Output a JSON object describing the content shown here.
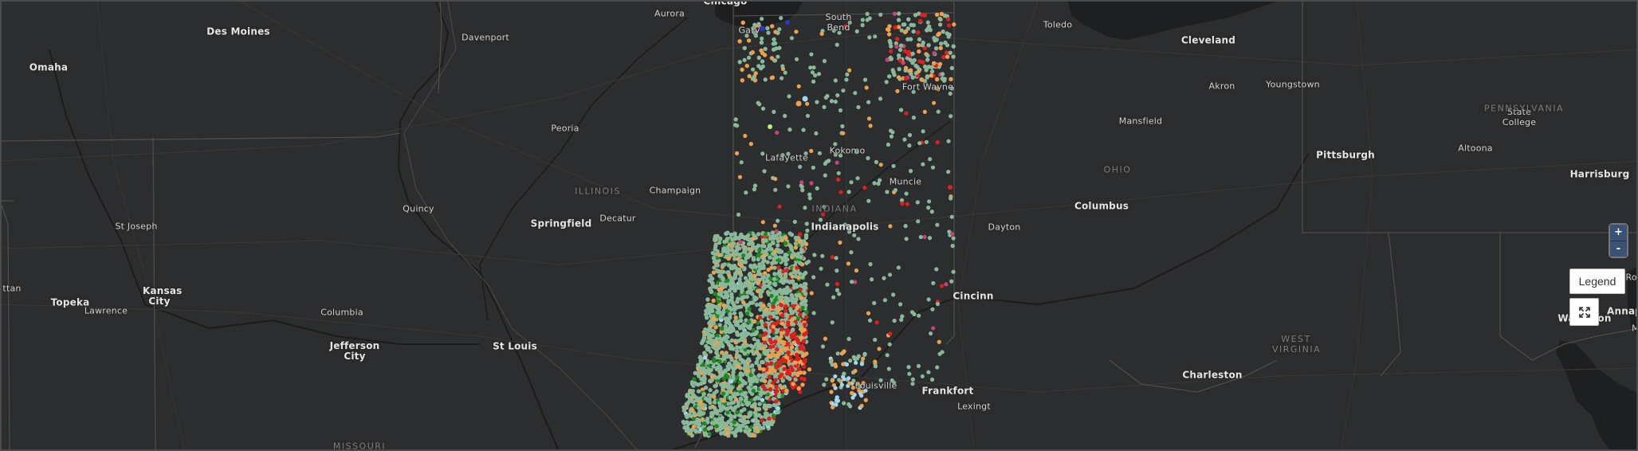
{
  "map": {
    "background": "#2c2d2e",
    "land_color": "#2c2d2e",
    "water_color": "#1e1f20",
    "road_color": "#343536",
    "border_color": "#4c4d4e",
    "points": {
      "colors": {
        "sage": "#8ab89a",
        "green": "#1f8a1f",
        "orange": "#f0a04b",
        "red": "#e01e1e",
        "light_blue": "#9fd8f2",
        "magenta": "#c8427a",
        "blue": "#2c36c8",
        "lime": "#b8f07a"
      }
    },
    "city_labels": [
      {
        "name": "Des Moines",
        "bold": true
      },
      {
        "name": "Omaha",
        "bold": true
      },
      {
        "name": "Davenport",
        "bold": false
      },
      {
        "name": "Aurora",
        "bold": false
      },
      {
        "name": "Chicago",
        "bold": true
      },
      {
        "name": "Gary",
        "bold": false
      },
      {
        "name": "South Bend",
        "bold": false
      },
      {
        "name": "Toledo",
        "bold": false
      },
      {
        "name": "Cleveland",
        "bold": true
      },
      {
        "name": "Akron",
        "bold": false
      },
      {
        "name": "Youngstown",
        "bold": false
      },
      {
        "name": "Fort Wayne",
        "bold": false
      },
      {
        "name": "Peoria",
        "bold": false
      },
      {
        "name": "Lafayette",
        "bold": false
      },
      {
        "name": "Kokomo",
        "bold": false
      },
      {
        "name": "Mansfield",
        "bold": false
      },
      {
        "name": "Pittsburgh",
        "bold": true
      },
      {
        "name": "Altoona",
        "bold": false
      },
      {
        "name": "State College",
        "bold": false
      },
      {
        "name": "Harrisburg",
        "bold": true
      },
      {
        "name": "Champaign",
        "bold": false
      },
      {
        "name": "Muncie",
        "bold": false
      },
      {
        "name": "Columbus",
        "bold": true
      },
      {
        "name": "St Joseph",
        "bold": false
      },
      {
        "name": "Quincy",
        "bold": false
      },
      {
        "name": "Springfield",
        "bold": true
      },
      {
        "name": "Decatur",
        "bold": false
      },
      {
        "name": "Indianapolis",
        "bold": true
      },
      {
        "name": "Dayton",
        "bold": false
      },
      {
        "name": "ttan",
        "bold": false
      },
      {
        "name": "Topeka",
        "bold": true
      },
      {
        "name": "Kansas City",
        "bold": true
      },
      {
        "name": "Lawrence",
        "bold": false
      },
      {
        "name": "Columbia",
        "bold": false
      },
      {
        "name": "Cincinn",
        "bold": true
      },
      {
        "name": "Annap",
        "bold": true
      },
      {
        "name": "Jefferson City",
        "bold": true
      },
      {
        "name": "St Louis",
        "bold": true
      },
      {
        "name": "Louisville",
        "bold": false
      },
      {
        "name": "Frankfort",
        "bold": true
      },
      {
        "name": "Lexingt",
        "bold": false
      },
      {
        "name": "Charleston",
        "bold": true
      },
      {
        "name": "Wa",
        "bold": true
      },
      {
        "name": "on",
        "bold": true
      },
      {
        "name": "Ror",
        "bold": false
      },
      {
        "name": "M",
        "bold": false
      }
    ],
    "state_labels": [
      "ILLINOIS",
      "INDIANA",
      "OHIO",
      "PENNSYLVANIA",
      "WEST VIRGINIA",
      "MISSOURI"
    ]
  },
  "controls": {
    "zoom_in_label": "+",
    "zoom_out_label": "-",
    "legend_label": "Legend",
    "fullscreen_icon": "expand-arrows-icon"
  }
}
